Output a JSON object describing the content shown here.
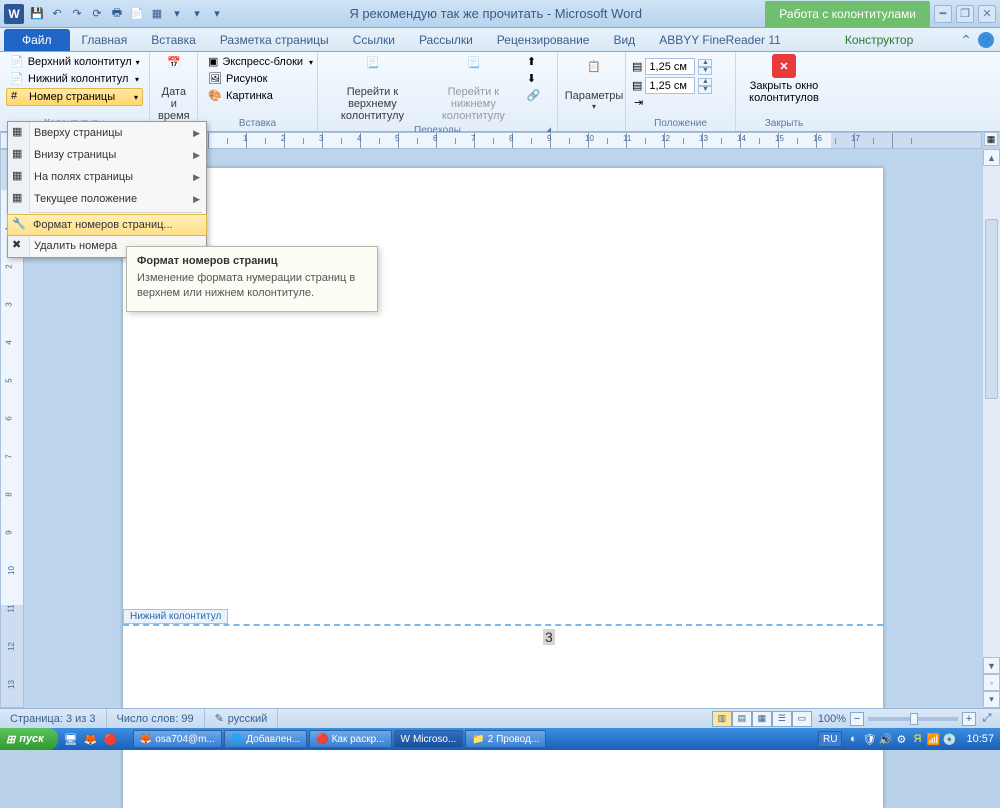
{
  "title": "Я рекомендую так же прочитать  -  Microsoft Word",
  "context_tab_label": "Работа с колонтитулами",
  "qat": [
    "save",
    "undo",
    "redo",
    "refresh",
    "print",
    "quickprint",
    "new",
    "open",
    "more",
    "dd"
  ],
  "tabs": {
    "file": "Файл",
    "items": [
      "Главная",
      "Вставка",
      "Разметка страницы",
      "Ссылки",
      "Рассылки",
      "Рецензирование",
      "Вид",
      "ABBYY FineReader 11"
    ],
    "context": "Конструктор"
  },
  "ribbon": {
    "hf_group": {
      "top_header": "Верхний колонтитул",
      "bottom_header": "Нижний колонтитул",
      "page_number": "Номер страницы",
      "label": "Колонтитулы"
    },
    "datetime": {
      "line1": "Дата и",
      "line2": "время"
    },
    "insert_group": {
      "quickparts": "Экспресс-блоки",
      "picture": "Рисунок",
      "clipart": "Картинка",
      "label": "Вставка"
    },
    "nav_group": {
      "goto_header_l1": "Перейти к верхнему",
      "goto_header_l2": "колонтитулу",
      "goto_footer_l1": "Перейти к нижнему",
      "goto_footer_l2": "колонтитулу",
      "label": "Переходы"
    },
    "options_group": {
      "label": "Параметры"
    },
    "position_group": {
      "top_value": "1,25 см",
      "bottom_value": "1,25 см",
      "label": "Положение"
    },
    "close_group": {
      "line1": "Закрыть окно",
      "line2": "колонтитулов",
      "label": "Закрыть"
    }
  },
  "dropdown": {
    "items": [
      {
        "label": "Вверху страницы",
        "sub": true,
        "u": "В"
      },
      {
        "label": "Внизу страницы",
        "sub": true,
        "u": "В"
      },
      {
        "label": "На полях страницы",
        "sub": true,
        "u": ""
      },
      {
        "label": "Текущее положение",
        "sub": true,
        "u": "Т"
      }
    ],
    "format": "Формат номеров страниц...",
    "remove": "Удалить номера"
  },
  "tooltip": {
    "title": "Формат номеров страниц",
    "body": "Изменение формата нумерации страниц в верхнем или нижнем колонтитуле."
  },
  "page": {
    "footer_tag": "Нижний колонтитул",
    "page_number_display": "3"
  },
  "ruler_numbers": [
    "1",
    "2",
    "3",
    "4",
    "5",
    "6",
    "7",
    "8",
    "9",
    "10",
    "11",
    "12",
    "13",
    "14",
    "15",
    "16",
    "17"
  ],
  "status": {
    "page": "Страница: 3 из 3",
    "words": "Число слов: 99",
    "lang": "русский",
    "zoom": "100%"
  },
  "taskbar": {
    "start": "пуск",
    "tasks": [
      {
        "label": "osa704@m...",
        "icon": "ff"
      },
      {
        "label": "Добавлен...",
        "icon": "chrome"
      },
      {
        "label": "Как раскр...",
        "icon": "opera"
      },
      {
        "label": "Microso...",
        "icon": "word",
        "active": true
      },
      {
        "label": "2 Провод...",
        "icon": "folder"
      }
    ],
    "lang": "RU",
    "clock": "10:57"
  }
}
